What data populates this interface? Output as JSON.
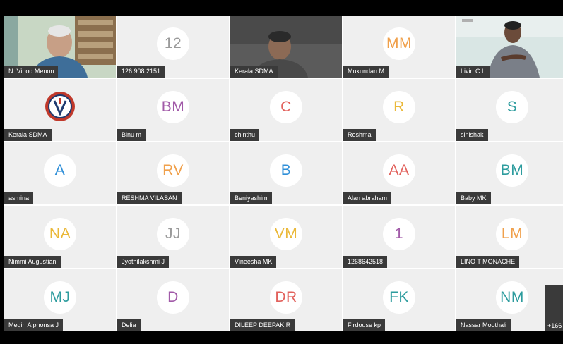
{
  "colors": {
    "orange": "#f0a04b",
    "purple": "#a15aa8",
    "red": "#e2615c",
    "yellow": "#eab838",
    "teal": "#2d9c9e",
    "blue": "#2f8fd8",
    "lightgray": "#999999"
  },
  "participants": [
    {
      "name": "N. Vinod Menon",
      "type": "video"
    },
    {
      "name": "126 908 2151",
      "initials": "12",
      "color": "#999999"
    },
    {
      "name": "Kerala SDMA",
      "type": "video"
    },
    {
      "name": "Mukundan M",
      "initials": "MM",
      "color": "#f0a04b"
    },
    {
      "name": "Livin C L",
      "type": "video"
    },
    {
      "name": "Kerala SDMA",
      "type": "logo"
    },
    {
      "name": "Binu m",
      "initials": "BM",
      "color": "#a15aa8"
    },
    {
      "name": "chinthu",
      "initials": "C",
      "color": "#e2615c"
    },
    {
      "name": "Reshma",
      "initials": "R",
      "color": "#eab838"
    },
    {
      "name": "sinishak",
      "initials": "S",
      "color": "#2d9c9e"
    },
    {
      "name": "asmina",
      "initials": "A",
      "color": "#2f8fd8"
    },
    {
      "name": "RESHMA VILASAN",
      "initials": "RV",
      "color": "#f0a04b"
    },
    {
      "name": "Beniyashim",
      "initials": "B",
      "color": "#2f8fd8"
    },
    {
      "name": "Alan abraham",
      "initials": "AA",
      "color": "#e2615c"
    },
    {
      "name": "Baby MK",
      "initials": "BM",
      "color": "#2d9c9e"
    },
    {
      "name": "Nimmi Augustian",
      "initials": "NA",
      "color": "#eab838"
    },
    {
      "name": "Jyothilakshmi J",
      "initials": "JJ",
      "color": "#999999"
    },
    {
      "name": "Vineesha MK",
      "initials": "VM",
      "color": "#eab838"
    },
    {
      "name": "1268642518",
      "initials": "1",
      "color": "#a15aa8"
    },
    {
      "name": "LINO T MONACHE",
      "initials": "LM",
      "color": "#f0a04b"
    },
    {
      "name": "Megin Alphonsa J",
      "initials": "MJ",
      "color": "#2d9c9e"
    },
    {
      "name": "Delia",
      "initials": "D",
      "color": "#a15aa8"
    },
    {
      "name": "DILEEP DEEPAK R",
      "initials": "DR",
      "color": "#e2615c"
    },
    {
      "name": "Firdouse kp",
      "initials": "FK",
      "color": "#2d9c9e"
    },
    {
      "name": "Nassar Moothali",
      "initials": "NM",
      "color": "#2d9c9e"
    }
  ],
  "overflow": {
    "label": "+166"
  }
}
